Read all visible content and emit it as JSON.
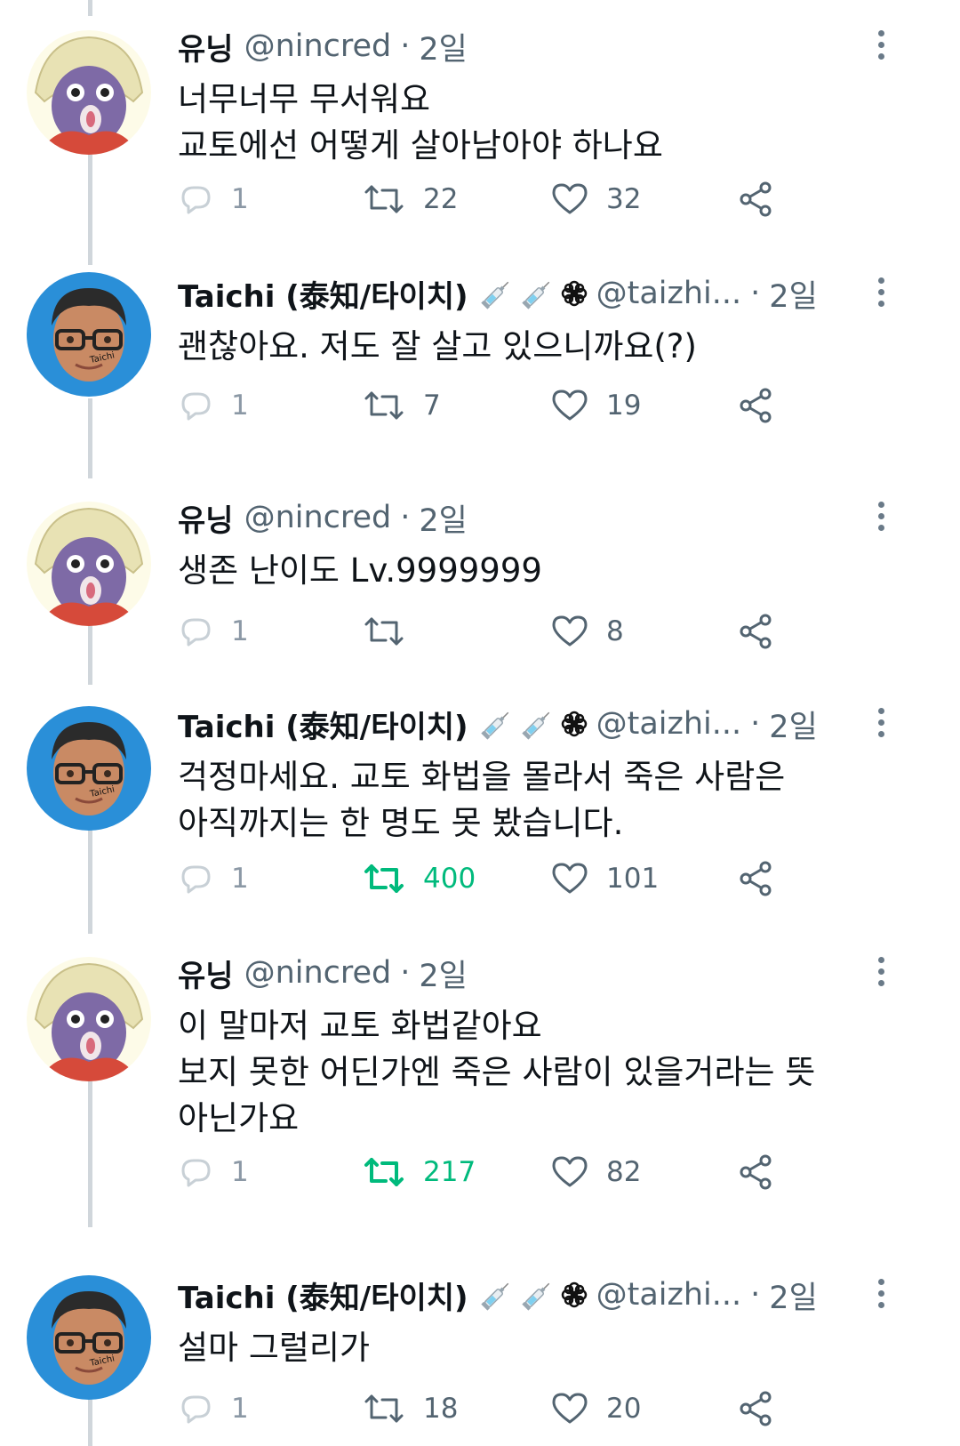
{
  "accent": {
    "retweet_active": "#00ba7c",
    "muted": "#536471"
  },
  "users": {
    "yuning": {
      "name": "유닝",
      "handle": "@nincred"
    },
    "taichi": {
      "name": "Taichi (泰知/타이치)",
      "handle": "@taizhi...",
      "avatar_label": "Taichi",
      "name_emojis": [
        "syringe",
        "syringe",
        "flower-icon"
      ]
    }
  },
  "tweets": [
    {
      "name": "유닝",
      "handle": "@nincred",
      "sep": "·",
      "time": "2일",
      "lines": [
        "너무너무 무서워요",
        "교토에선 어떻게 살아남아야 하나요"
      ],
      "replies": "1",
      "retweets": "22",
      "retweeted": false,
      "likes": "32"
    },
    {
      "name": "Taichi (泰知/타이치)",
      "handle": "@taizhi...",
      "sep": "·",
      "time": "2일",
      "lines": [
        "괜찮아요. 저도 잘 살고 있으니까요(?)"
      ],
      "replies": "1",
      "retweets": "7",
      "retweeted": false,
      "likes": "19"
    },
    {
      "name": "유닝",
      "handle": "@nincred",
      "sep": "·",
      "time": "2일",
      "lines": [
        "생존 난이도 Lv.9999999"
      ],
      "replies": "1",
      "retweets": "",
      "retweeted": false,
      "likes": "8"
    },
    {
      "name": "Taichi (泰知/타이치)",
      "handle": "@taizhi...",
      "sep": "·",
      "time": "2일",
      "lines": [
        "걱정마세요. 교토 화법을 몰라서 죽은 사람은",
        "아직까지는 한 명도 못 봤습니다."
      ],
      "replies": "1",
      "retweets": "400",
      "retweeted": true,
      "likes": "101"
    },
    {
      "name": "유닝",
      "handle": "@nincred",
      "sep": "·",
      "time": "2일",
      "lines": [
        "이 말마저 교토 화법같아요",
        "보지 못한 어딘가엔 죽은 사람이 있을거라는 뜻",
        "아닌가요"
      ],
      "replies": "1",
      "retweets": "217",
      "retweeted": true,
      "likes": "82"
    },
    {
      "name": "Taichi (泰知/타이치)",
      "handle": "@taizhi...",
      "sep": "·",
      "time": "2일",
      "lines": [
        "설마 그럴리가"
      ],
      "replies": "1",
      "retweets": "18",
      "retweeted": false,
      "likes": "20"
    }
  ]
}
